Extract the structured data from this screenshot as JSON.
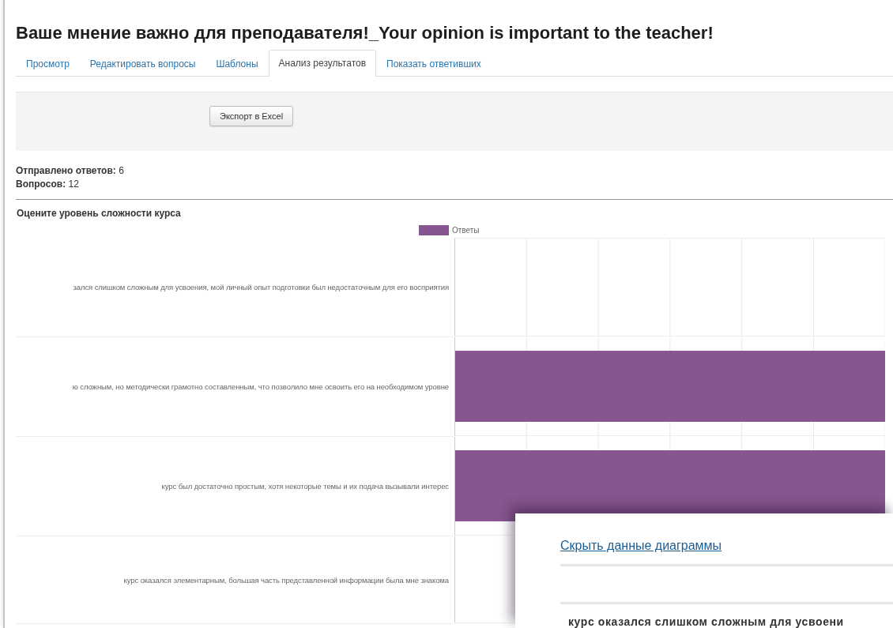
{
  "page": {
    "title": "Ваше мнение важно для преподавателя!_Your opinion is important to the teacher!"
  },
  "tabs": [
    {
      "label": "Просмотр",
      "selected": false
    },
    {
      "label": "Редактировать вопросы",
      "selected": false
    },
    {
      "label": "Шаблоны",
      "selected": false
    },
    {
      "label": "Анализ результатов",
      "selected": true
    },
    {
      "label": "Показать ответивших",
      "selected": false
    }
  ],
  "export_button": "Экспорт в Excel",
  "stats": [
    "**Отправлено ответов:** 6",
    "**Вопросов:** 12"
  ],
  "question": {
    "title": "Оцените уровень сложности курса",
    "legend": {
      "label": "Ответы",
      "color": "#87558f"
    },
    "bars": [
      {
        "label": "зался слишком сложным для усвоения, мой личный опыт подготовки был недостаточным для его восприятия",
        "level": 0
      },
      {
        "label": "ю сложным, но методически грамотно составленным, что позволило мне освоить его на необходимом уровне",
        "level": 1
      },
      {
        "label": "курс был достаточно простым, хотя некоторые темы и их подача вызывали интерес",
        "level": 1
      },
      {
        "label": "курс оказался элементарным, большая часть представленной информации была мне знакома",
        "level": 0
      }
    ]
  },
  "popup": {
    "link": "Скрыть данные диаграммы",
    "row_text": "курс оказался слишком сложным для усвоени"
  }
}
